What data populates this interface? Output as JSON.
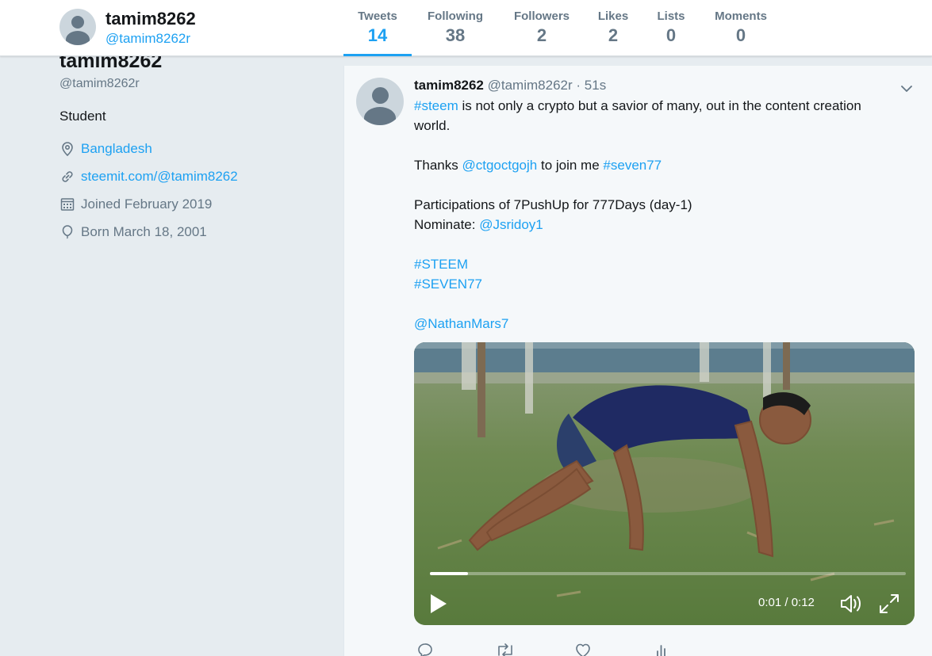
{
  "header": {
    "name": "tamim8262",
    "handle": "@tamim8262r",
    "nav": [
      {
        "label": "Tweets",
        "value": "14",
        "active": true
      },
      {
        "label": "Following",
        "value": "38"
      },
      {
        "label": "Followers",
        "value": "2"
      },
      {
        "label": "Likes",
        "value": "2"
      },
      {
        "label": "Lists",
        "value": "0"
      },
      {
        "label": "Moments",
        "value": "0"
      }
    ]
  },
  "profile": {
    "name": "tamim8262",
    "handle": "@tamim8262r",
    "bio": "Student",
    "location": "Bangladesh",
    "website": "steemit.com/@tamim8262",
    "joined": "Joined February 2019",
    "born": "Born March 18, 2001"
  },
  "tweet": {
    "name": "tamim8262",
    "handle": "@tamim8262r",
    "separator": "·",
    "time": "51s",
    "line1_hashtag": "#steem",
    "line1_text": " is not only a crypto but a savior of many, out in the content creation world.",
    "line2_text_a": "Thanks ",
    "line2_mention": "@ctgoctgojh",
    "line2_text_b": " to join me ",
    "line2_hashtag": "#seven77",
    "line3": "Participations of 7PushUp for 777Days (day-1)",
    "line4_text": "Nominate: ",
    "line4_mention": "@Jsridoy1",
    "hashtag_steem": "#STEEM",
    "hashtag_seven": "#SEVEN77",
    "mention_nathan": "@NathanMars7",
    "video": {
      "time": "0:01 / 0:12",
      "progress": 0.08
    }
  },
  "icons": {
    "location": "location-pin-icon",
    "link": "link-icon",
    "calendar": "calendar-icon",
    "balloon": "balloon-icon",
    "caret": "chevron-down-icon",
    "reply": "reply-icon",
    "retweet": "retweet-icon",
    "like": "heart-icon",
    "analytics": "analytics-icon"
  },
  "colors": {
    "accent": "#1da1f2",
    "secondary_text": "#657786",
    "background": "#e6ecf0"
  }
}
